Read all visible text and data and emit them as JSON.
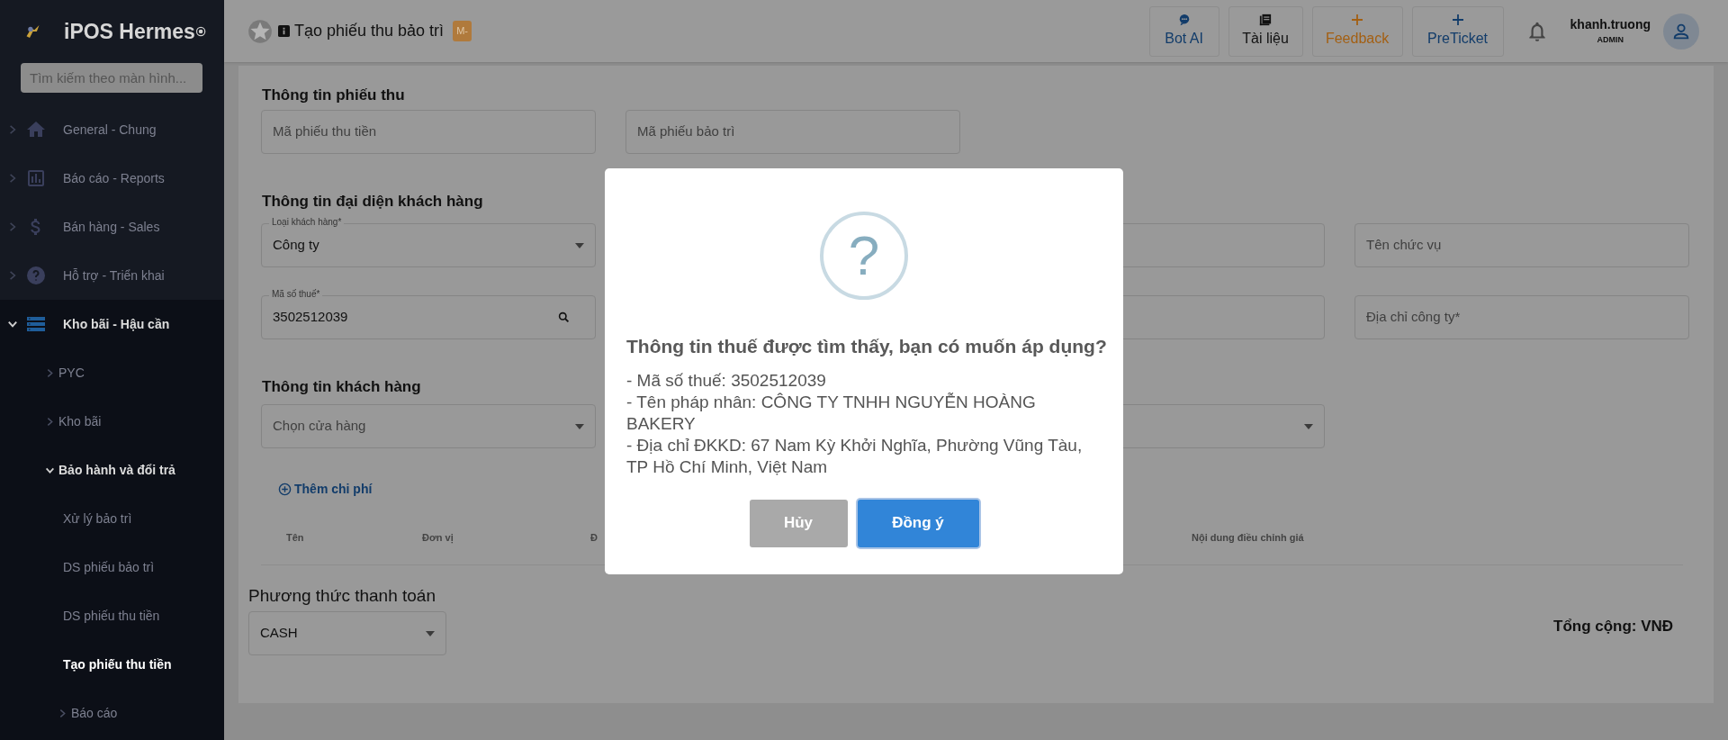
{
  "sidebar": {
    "app_name": "iPOS Hermes",
    "search": {
      "placeholder": "Tìm kiếm theo màn hình..."
    },
    "items": [
      {
        "label": "General - Chung",
        "expanded": false,
        "selected": false
      },
      {
        "label": "Báo cáo - Reports",
        "expanded": false,
        "selected": false
      },
      {
        "label": "Bán hàng - Sales",
        "expanded": false,
        "selected": false
      },
      {
        "label": "Hỗ trợ - Triển khai",
        "expanded": false,
        "selected": false
      },
      {
        "label": "Kho bãi - Hậu cần",
        "expanded": true,
        "selected": false,
        "children": [
          {
            "label": "PYC",
            "expanded": false,
            "selected": false
          },
          {
            "label": "Kho bãi",
            "expanded": false,
            "selected": false
          },
          {
            "label": "Bảo hành và đổi trả",
            "expanded": true,
            "selected": false,
            "children": [
              {
                "label": "Xử lý bảo trì",
                "selected": false
              },
              {
                "label": "DS phiếu bảo trì",
                "selected": false
              },
              {
                "label": "DS phiếu thu tiền",
                "selected": false
              },
              {
                "label": "Tạo phiếu thu tiền",
                "selected": true
              },
              {
                "label": "Báo cáo",
                "expanded": false,
                "selected": false
              }
            ]
          }
        ]
      }
    ]
  },
  "header": {
    "title": "Tạo phiếu thu bảo trì",
    "badge": "M-",
    "buttons": [
      {
        "kind": "chat",
        "label": "Bot AI"
      },
      {
        "kind": "book",
        "label": "Tài liệu"
      },
      {
        "kind": "plus-orange",
        "label": "Feedback"
      },
      {
        "kind": "plus",
        "label": "PreTicket"
      }
    ],
    "user": {
      "name": "khanh.truong",
      "role": "ADMIN"
    }
  },
  "form": {
    "receipt_section": {
      "title": "Thông tin phiếu thu",
      "fields": [
        {
          "placeholder": "Mã phiếu thu tiền"
        },
        {
          "placeholder": "Mã phiếu bảo trì"
        }
      ]
    },
    "representative_section": {
      "title": "Thông tin đại diện khách hàng",
      "customer_type": {
        "label": "Loại khách hàng*",
        "value": "Công ty"
      },
      "tax_code": {
        "label": "Mã số thuế*",
        "value": "3502512039"
      },
      "position": {
        "placeholder": "Tên chức vụ"
      },
      "company_address": {
        "placeholder": "Địa chỉ công ty*"
      }
    },
    "customer_section": {
      "title": "Thông tin khách hàng",
      "store_select": {
        "placeholder": "Chọn cửa hàng"
      }
    },
    "add_cost_link": "Thêm chi phí",
    "table": {
      "columns": [
        "Tên",
        "Đơn vị",
        "Đ",
        "Nội dung điều chỉnh giá"
      ]
    },
    "payment": {
      "title": "Phương thức thanh toán",
      "value": "CASH"
    },
    "total": "Tổng cộng: VNĐ"
  },
  "dialog": {
    "title": "Thông tin thuế được tìm thấy, bạn có muốn áp dụng?",
    "lines": [
      "- Mã số thuế: 3502512039",
      "- Tên pháp nhân: CÔNG TY TNHH NGUYỄN HOÀNG BAKERY",
      "- Địa chỉ ĐKKD: 67 Nam Kỳ Khởi Nghĩa, Phường Vũng Tàu, TP Hồ Chí Minh, Việt Nam"
    ],
    "icon_text": "?",
    "cancel": "Hủy",
    "confirm": "Đồng ý"
  }
}
